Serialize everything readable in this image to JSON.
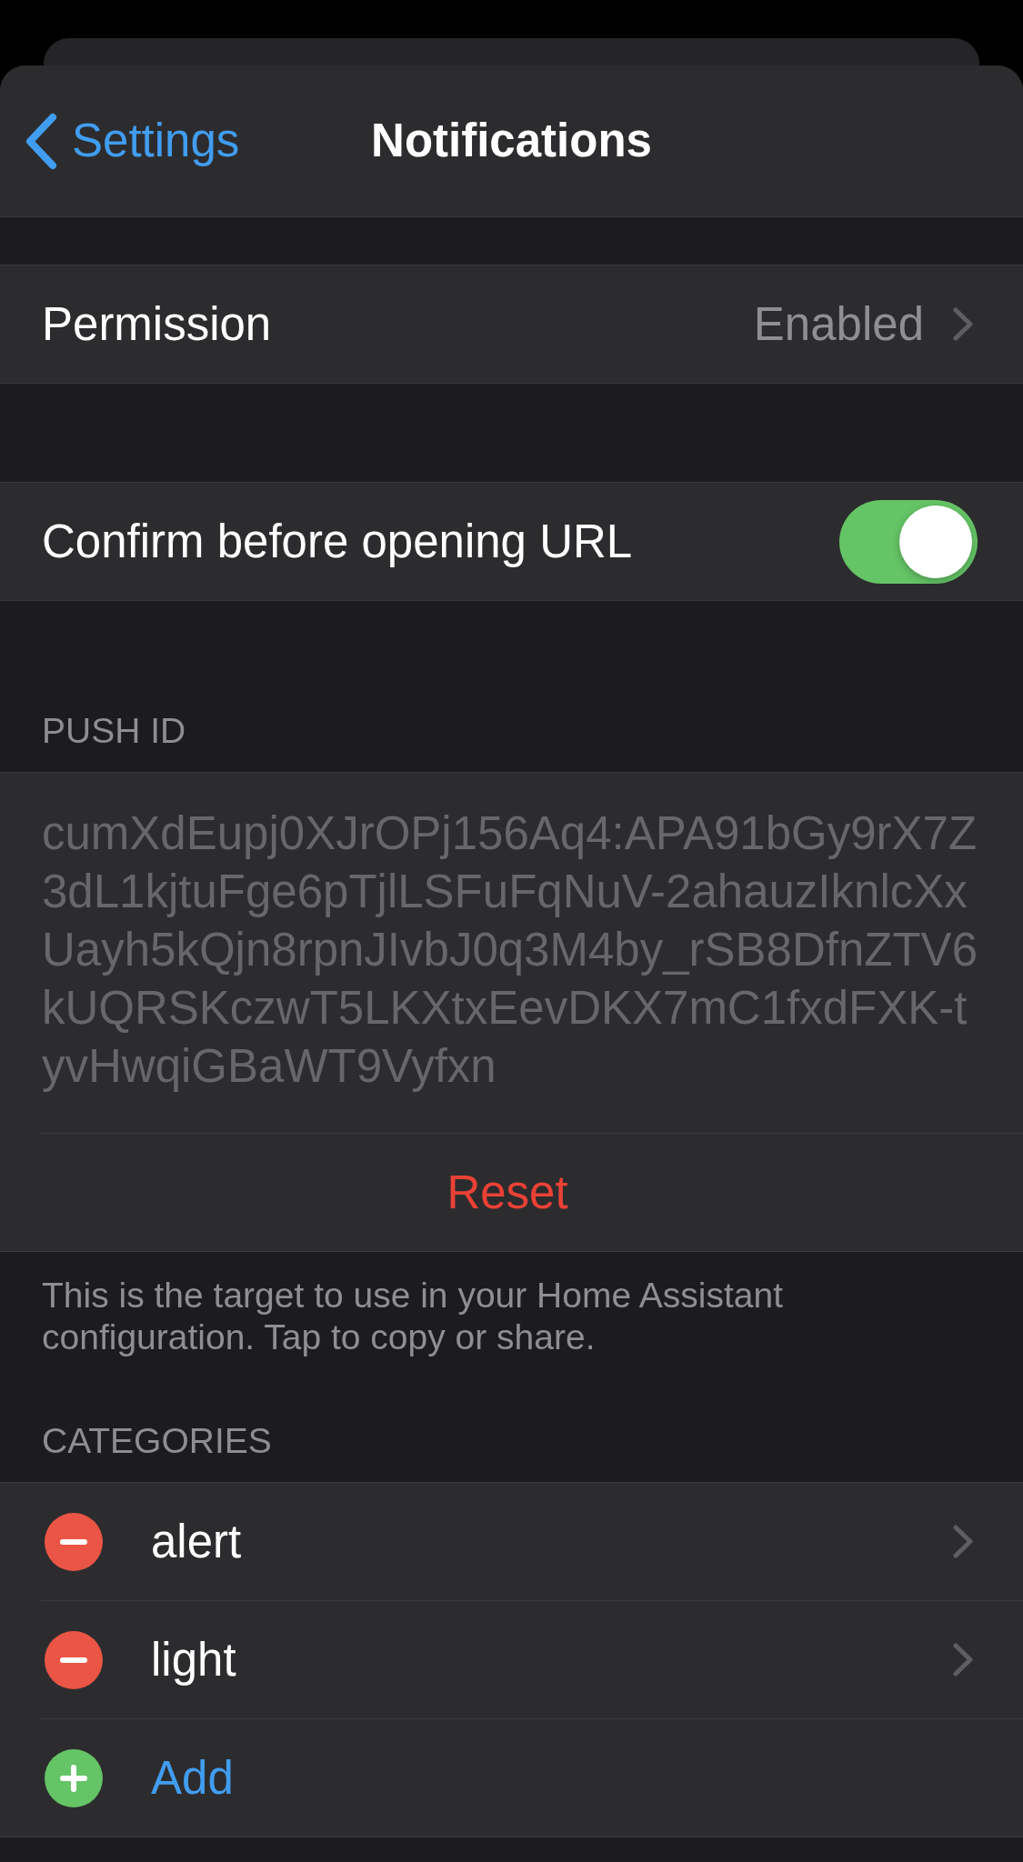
{
  "navigation_bar": {
    "back_label": "Settings",
    "title": "Notifications"
  },
  "sections": [
    {
      "rows": [
        {
          "kind": "disclosure",
          "label": "Permission",
          "value": "Enabled"
        }
      ]
    },
    {
      "rows": [
        {
          "kind": "toggle",
          "label": "Confirm before opening URL",
          "on": true
        }
      ]
    },
    {
      "header": "PUSH ID",
      "rows": [
        {
          "kind": "text",
          "text": "cumXdEupj0XJrOPj156Aq4:APA91bGy9rX7Z3dL1kjtuFge6pTjlLSFuFqNuV-2ahauzIknlcXxUayh5kQjn8rpnJIvbJ0q3M4by_rSB8DfnZTV6kUQRSKczwT5LKXtxEevDKX7mC1fxdFXK-tyvHwqiGBaWT9Vyfxn"
        },
        {
          "kind": "button",
          "label": "Reset",
          "destructive": true
        }
      ],
      "footer": "This is the target to use in your Home Assistant configuration. Tap to copy or share."
    },
    {
      "header": "CATEGORIES",
      "rows": [
        {
          "kind": "delete",
          "label": "alert"
        },
        {
          "kind": "delete",
          "label": "light"
        },
        {
          "kind": "insert",
          "label": "Add"
        }
      ]
    }
  ]
}
